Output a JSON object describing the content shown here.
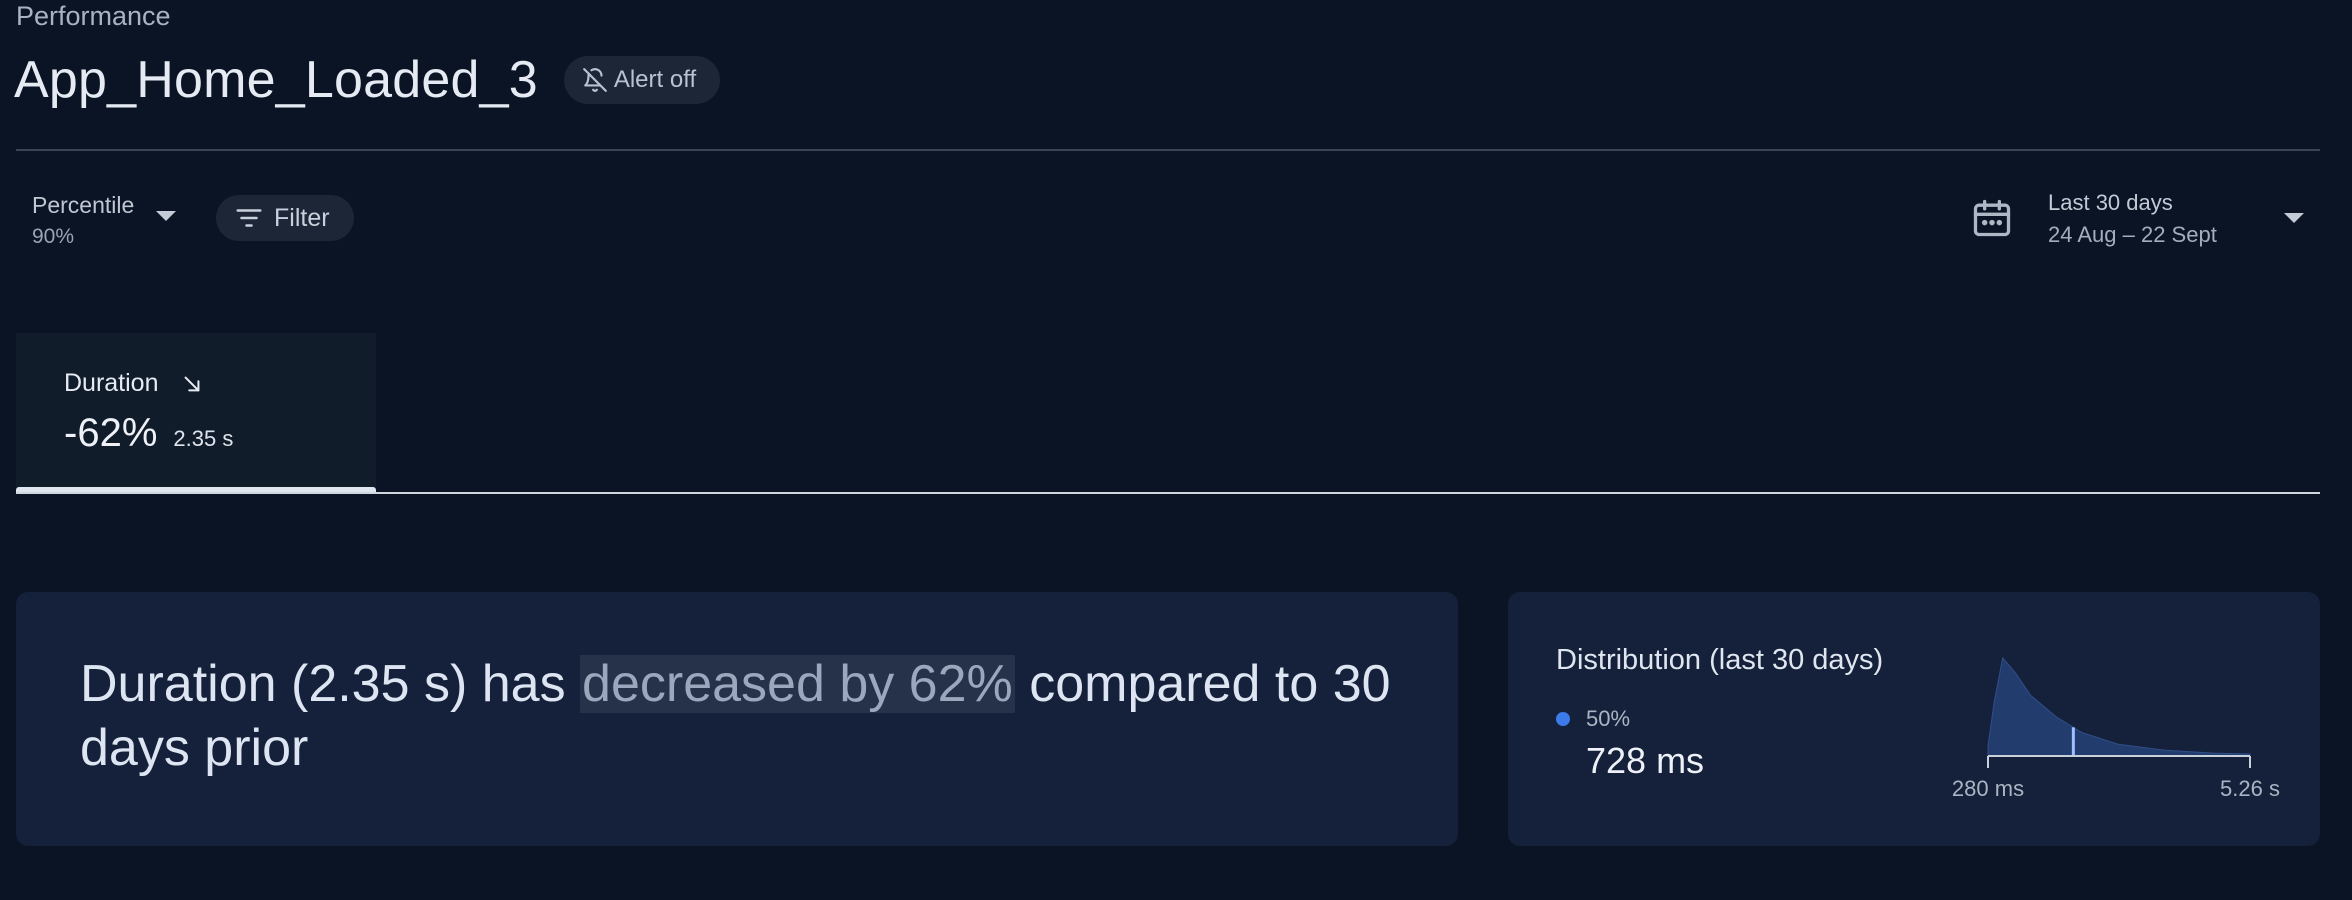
{
  "breadcrumb": "Performance",
  "trace": {
    "name": "App_Home_Loaded_3",
    "alert_label": "Alert off"
  },
  "toolbar": {
    "percentile_label": "Percentile",
    "percentile_value": "90%",
    "filter_label": "Filter",
    "date_label": "Last 30 days",
    "date_value": "24 Aug – 22 Sept"
  },
  "metric_tab": {
    "name": "Duration",
    "trend_icon": "arrow-down-right-icon",
    "delta": "-62%",
    "value": "2.35 s",
    "selected": true
  },
  "summary": {
    "prefix": "Duration (2.35 s) has ",
    "highlight": "decreased by 62%",
    "suffix": " compared to 30 days prior"
  },
  "distribution": {
    "title": "Distribution (last 30 days)",
    "percentile_label": "50%",
    "value": "728 ms",
    "min_label": "280 ms",
    "max_label": "5.26 s",
    "dot_color": "#3d7bea"
  },
  "colors": {
    "background": "#0a1424",
    "card": "#15213a",
    "accent": "#3d7bea"
  },
  "chart_data": {
    "type": "area",
    "title": "",
    "xlabel": "",
    "ylabel": "",
    "x_scale": "log",
    "xlim_labels": [
      "280 ms",
      "5.26 s"
    ],
    "x": [
      280,
      300,
      330,
      380,
      450,
      600,
      800,
      1200,
      2000,
      3500,
      5260
    ],
    "series": [
      {
        "values": [
          0.1,
          0.55,
          1.0,
          0.85,
          0.62,
          0.4,
          0.24,
          0.12,
          0.06,
          0.03,
          0.02
        ]
      }
    ],
    "marker": {
      "label": "50%",
      "x": 728
    }
  }
}
